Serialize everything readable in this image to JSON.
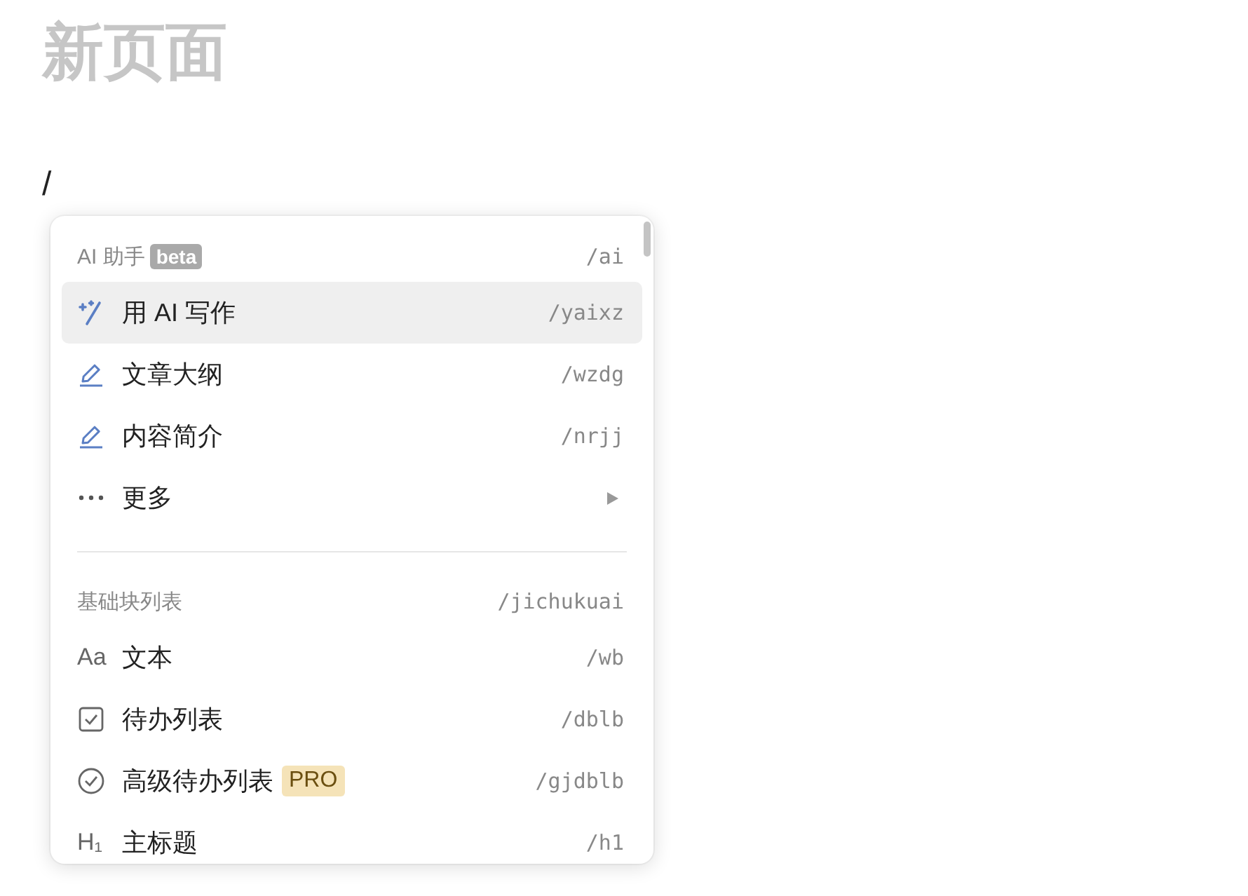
{
  "page": {
    "title": "新页面",
    "typed_text": "/"
  },
  "menu": {
    "sections": [
      {
        "title": "AI 助手",
        "badge": "beta",
        "shortcut": "/ai",
        "items": [
          {
            "kind": "sparkle",
            "label": "用 AI 写作",
            "shortcut": "/yaixz",
            "selected": true
          },
          {
            "kind": "pencil",
            "label": "文章大纲",
            "shortcut": "/wzdg",
            "selected": false
          },
          {
            "kind": "pencil",
            "label": "内容简介",
            "shortcut": "/nrjj",
            "selected": false
          },
          {
            "kind": "dots",
            "label": "更多",
            "submenu": true,
            "selected": false
          }
        ]
      },
      {
        "title": "基础块列表",
        "shortcut": "/jichukuai",
        "items": [
          {
            "kind": "glyph",
            "glyph": "Aa",
            "label": "文本",
            "shortcut": "/wb",
            "selected": false
          },
          {
            "kind": "checkbox",
            "label": "待办列表",
            "shortcut": "/dblb",
            "selected": false
          },
          {
            "kind": "circle-check",
            "label": "高级待办列表",
            "badge": "PRO",
            "shortcut": "/gjdblb",
            "selected": false
          },
          {
            "kind": "heading",
            "glyph": "H₁",
            "label": "主标题",
            "shortcut": "/h1",
            "selected": false
          }
        ]
      }
    ]
  }
}
